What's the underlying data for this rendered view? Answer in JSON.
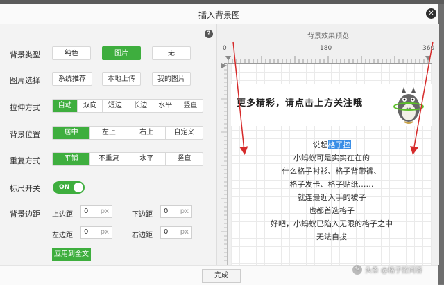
{
  "dialog": {
    "title": "插入背景图",
    "done_label": "完成"
  },
  "settings": {
    "bg_type": {
      "label": "背景类型",
      "options": [
        "纯色",
        "图片",
        "无"
      ],
      "selected": "图片"
    },
    "image_source": {
      "label": "图片选择",
      "options": [
        "系统推荐",
        "本地上传",
        "我的图片"
      ]
    },
    "stretch": {
      "label": "拉伸方式",
      "options": [
        "自动",
        "双向",
        "短边",
        "长边",
        "水平",
        "竖直"
      ],
      "selected": "自动"
    },
    "position": {
      "label": "背景位置",
      "options": [
        "居中",
        "左上",
        "右上",
        "自定义"
      ],
      "selected": "居中"
    },
    "repeat": {
      "label": "重复方式",
      "options": [
        "平铺",
        "不重复",
        "水平",
        "竖直"
      ],
      "selected": "平铺"
    },
    "ruler": {
      "label": "标尺开关",
      "state": "ON"
    },
    "margin": {
      "label": "背景边距",
      "top_label": "上边距",
      "bottom_label": "下边距",
      "left_label": "左边距",
      "right_label": "右边距",
      "top": "0",
      "bottom": "0",
      "left": "0",
      "right": "0",
      "unit": "px"
    },
    "apply_label": "应用到全文"
  },
  "preview": {
    "title": "背景效果预览",
    "ruler_ticks": [
      "0",
      "180",
      "360"
    ],
    "banner_text": "更多精彩，请点击上方关注哦",
    "lines": [
      {
        "pre": "说起",
        "hl": "格子控"
      },
      {
        "pre": "小蚂蚁可是实实在在的",
        "hl": ""
      },
      {
        "pre": "什么格子衬衫、格子背带裤、",
        "hl": ""
      },
      {
        "pre": "格子发卡、格子贴纸……",
        "hl": ""
      },
      {
        "pre": "就连最近入手的被子",
        "hl": ""
      },
      {
        "pre": "也都首选格子",
        "hl": ""
      },
      {
        "pre": "好吧，小蚂蚁已陷入无限的格子之中",
        "hl": ""
      },
      {
        "pre": "无法自拔",
        "hl": ""
      }
    ]
  },
  "watermark": {
    "text": "头条 @格子控问答",
    "icon": "comment-icon"
  },
  "colors": {
    "accent": "#3eae3e",
    "arrow": "#d62b2b",
    "highlight": "#3a8ee6"
  }
}
